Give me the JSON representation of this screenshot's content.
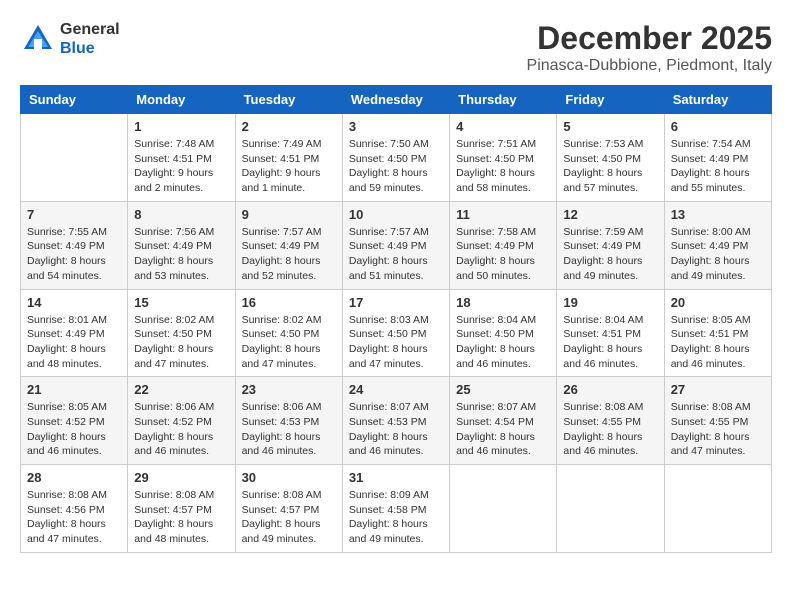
{
  "header": {
    "logo_general": "General",
    "logo_blue": "Blue",
    "title": "December 2025",
    "subtitle": "Pinasca-Dubbione, Piedmont, Italy"
  },
  "days_of_week": [
    "Sunday",
    "Monday",
    "Tuesday",
    "Wednesday",
    "Thursday",
    "Friday",
    "Saturday"
  ],
  "weeks": [
    [
      {
        "day": "",
        "sunrise": "",
        "sunset": "",
        "daylight": "",
        "empty": true
      },
      {
        "day": "1",
        "sunrise": "Sunrise: 7:48 AM",
        "sunset": "Sunset: 4:51 PM",
        "daylight": "Daylight: 9 hours and 2 minutes."
      },
      {
        "day": "2",
        "sunrise": "Sunrise: 7:49 AM",
        "sunset": "Sunset: 4:51 PM",
        "daylight": "Daylight: 9 hours and 1 minute."
      },
      {
        "day": "3",
        "sunrise": "Sunrise: 7:50 AM",
        "sunset": "Sunset: 4:50 PM",
        "daylight": "Daylight: 8 hours and 59 minutes."
      },
      {
        "day": "4",
        "sunrise": "Sunrise: 7:51 AM",
        "sunset": "Sunset: 4:50 PM",
        "daylight": "Daylight: 8 hours and 58 minutes."
      },
      {
        "day": "5",
        "sunrise": "Sunrise: 7:53 AM",
        "sunset": "Sunset: 4:50 PM",
        "daylight": "Daylight: 8 hours and 57 minutes."
      },
      {
        "day": "6",
        "sunrise": "Sunrise: 7:54 AM",
        "sunset": "Sunset: 4:49 PM",
        "daylight": "Daylight: 8 hours and 55 minutes."
      }
    ],
    [
      {
        "day": "7",
        "sunrise": "Sunrise: 7:55 AM",
        "sunset": "Sunset: 4:49 PM",
        "daylight": "Daylight: 8 hours and 54 minutes."
      },
      {
        "day": "8",
        "sunrise": "Sunrise: 7:56 AM",
        "sunset": "Sunset: 4:49 PM",
        "daylight": "Daylight: 8 hours and 53 minutes."
      },
      {
        "day": "9",
        "sunrise": "Sunrise: 7:57 AM",
        "sunset": "Sunset: 4:49 PM",
        "daylight": "Daylight: 8 hours and 52 minutes."
      },
      {
        "day": "10",
        "sunrise": "Sunrise: 7:57 AM",
        "sunset": "Sunset: 4:49 PM",
        "daylight": "Daylight: 8 hours and 51 minutes."
      },
      {
        "day": "11",
        "sunrise": "Sunrise: 7:58 AM",
        "sunset": "Sunset: 4:49 PM",
        "daylight": "Daylight: 8 hours and 50 minutes."
      },
      {
        "day": "12",
        "sunrise": "Sunrise: 7:59 AM",
        "sunset": "Sunset: 4:49 PM",
        "daylight": "Daylight: 8 hours and 49 minutes."
      },
      {
        "day": "13",
        "sunrise": "Sunrise: 8:00 AM",
        "sunset": "Sunset: 4:49 PM",
        "daylight": "Daylight: 8 hours and 49 minutes."
      }
    ],
    [
      {
        "day": "14",
        "sunrise": "Sunrise: 8:01 AM",
        "sunset": "Sunset: 4:49 PM",
        "daylight": "Daylight: 8 hours and 48 minutes."
      },
      {
        "day": "15",
        "sunrise": "Sunrise: 8:02 AM",
        "sunset": "Sunset: 4:50 PM",
        "daylight": "Daylight: 8 hours and 47 minutes."
      },
      {
        "day": "16",
        "sunrise": "Sunrise: 8:02 AM",
        "sunset": "Sunset: 4:50 PM",
        "daylight": "Daylight: 8 hours and 47 minutes."
      },
      {
        "day": "17",
        "sunrise": "Sunrise: 8:03 AM",
        "sunset": "Sunset: 4:50 PM",
        "daylight": "Daylight: 8 hours and 47 minutes."
      },
      {
        "day": "18",
        "sunrise": "Sunrise: 8:04 AM",
        "sunset": "Sunset: 4:50 PM",
        "daylight": "Daylight: 8 hours and 46 minutes."
      },
      {
        "day": "19",
        "sunrise": "Sunrise: 8:04 AM",
        "sunset": "Sunset: 4:51 PM",
        "daylight": "Daylight: 8 hours and 46 minutes."
      },
      {
        "day": "20",
        "sunrise": "Sunrise: 8:05 AM",
        "sunset": "Sunset: 4:51 PM",
        "daylight": "Daylight: 8 hours and 46 minutes."
      }
    ],
    [
      {
        "day": "21",
        "sunrise": "Sunrise: 8:05 AM",
        "sunset": "Sunset: 4:52 PM",
        "daylight": "Daylight: 8 hours and 46 minutes."
      },
      {
        "day": "22",
        "sunrise": "Sunrise: 8:06 AM",
        "sunset": "Sunset: 4:52 PM",
        "daylight": "Daylight: 8 hours and 46 minutes."
      },
      {
        "day": "23",
        "sunrise": "Sunrise: 8:06 AM",
        "sunset": "Sunset: 4:53 PM",
        "daylight": "Daylight: 8 hours and 46 minutes."
      },
      {
        "day": "24",
        "sunrise": "Sunrise: 8:07 AM",
        "sunset": "Sunset: 4:53 PM",
        "daylight": "Daylight: 8 hours and 46 minutes."
      },
      {
        "day": "25",
        "sunrise": "Sunrise: 8:07 AM",
        "sunset": "Sunset: 4:54 PM",
        "daylight": "Daylight: 8 hours and 46 minutes."
      },
      {
        "day": "26",
        "sunrise": "Sunrise: 8:08 AM",
        "sunset": "Sunset: 4:55 PM",
        "daylight": "Daylight: 8 hours and 46 minutes."
      },
      {
        "day": "27",
        "sunrise": "Sunrise: 8:08 AM",
        "sunset": "Sunset: 4:55 PM",
        "daylight": "Daylight: 8 hours and 47 minutes."
      }
    ],
    [
      {
        "day": "28",
        "sunrise": "Sunrise: 8:08 AM",
        "sunset": "Sunset: 4:56 PM",
        "daylight": "Daylight: 8 hours and 47 minutes."
      },
      {
        "day": "29",
        "sunrise": "Sunrise: 8:08 AM",
        "sunset": "Sunset: 4:57 PM",
        "daylight": "Daylight: 8 hours and 48 minutes."
      },
      {
        "day": "30",
        "sunrise": "Sunrise: 8:08 AM",
        "sunset": "Sunset: 4:57 PM",
        "daylight": "Daylight: 8 hours and 49 minutes."
      },
      {
        "day": "31",
        "sunrise": "Sunrise: 8:09 AM",
        "sunset": "Sunset: 4:58 PM",
        "daylight": "Daylight: 8 hours and 49 minutes."
      },
      {
        "day": "",
        "sunrise": "",
        "sunset": "",
        "daylight": "",
        "empty": true
      },
      {
        "day": "",
        "sunrise": "",
        "sunset": "",
        "daylight": "",
        "empty": true
      },
      {
        "day": "",
        "sunrise": "",
        "sunset": "",
        "daylight": "",
        "empty": true
      }
    ]
  ]
}
